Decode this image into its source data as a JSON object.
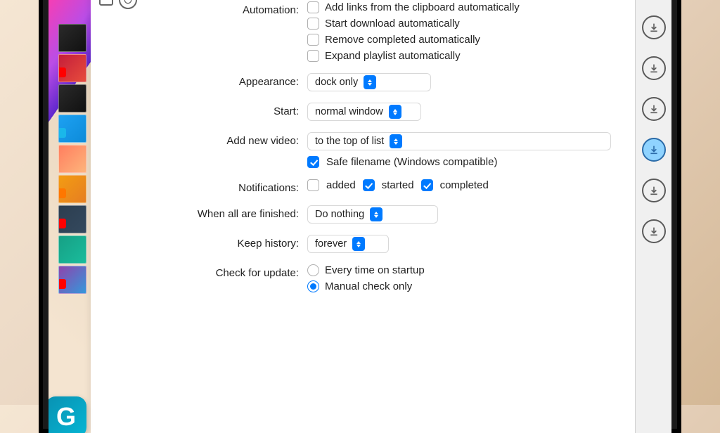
{
  "sections": {
    "automation": {
      "label": "Automation:",
      "opts": {
        "clipboard": "Add links from the clipboard automatically",
        "start": "Start download automatically",
        "remove": "Remove completed automatically",
        "expand": "Expand playlist automatically"
      }
    },
    "appearance": {
      "label": "Appearance:",
      "value": "dock only"
    },
    "start": {
      "label": "Start:",
      "value": "normal window"
    },
    "addvideo": {
      "label": "Add new video:",
      "value": "to the top of list"
    },
    "safefile": {
      "label": "Safe filename (Windows compatible)"
    },
    "notifications": {
      "label": "Notifications:",
      "added": "added",
      "started": "started",
      "completed": "completed"
    },
    "finished": {
      "label": "When all are finished:",
      "value": "Do nothing"
    },
    "history": {
      "label": "Keep history:",
      "value": "forever"
    },
    "update": {
      "label": "Check for update:",
      "startup": "Every time on startup",
      "manual": "Manual check only"
    }
  }
}
